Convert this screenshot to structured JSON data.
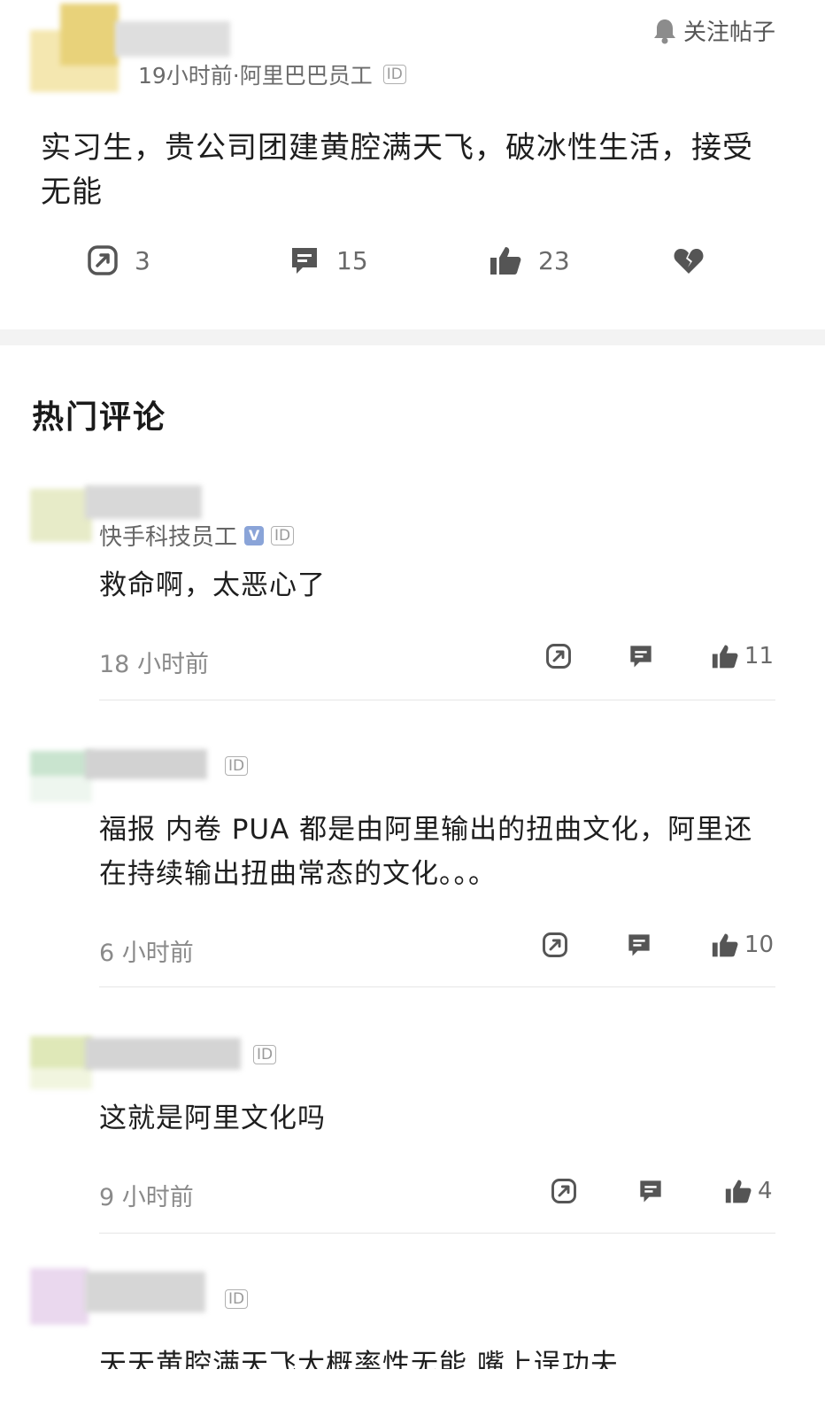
{
  "post": {
    "meta": "19小时前·阿里巴巴员工",
    "id_badge": "ID",
    "follow_label": "关注帖子",
    "body": "实习生，贵公司团建黄腔满天飞，破冰性生活，接受无能",
    "stats": {
      "share": "3",
      "comments": "15",
      "likes": "23"
    }
  },
  "section_title": "热门评论",
  "comments": [
    {
      "author": "快手科技员工",
      "verified_badge": "V",
      "id_badge": "ID",
      "text": "救命啊，太恶心了",
      "time": "18 小时前",
      "likes": "11"
    },
    {
      "author": "",
      "id_badge": "ID",
      "text": "福报 内卷 PUA 都是由阿里输出的扭曲文化，阿里还在持续输出扭曲常态的文化。。。",
      "time": "6 小时前",
      "likes": "10"
    },
    {
      "author": "",
      "id_badge": "ID",
      "text": "这就是阿里文化吗",
      "time": "9 小时前",
      "likes": "4"
    },
    {
      "author": "",
      "id_badge": "ID",
      "text": "天天黄腔满天飞大概率性无能 嘴上逞功夫"
    }
  ],
  "icons": {
    "share": "share-icon",
    "comment": "comment-icon",
    "like": "thumbs-up-icon",
    "dislike": "broken-heart-icon",
    "bell": "bell-icon"
  }
}
